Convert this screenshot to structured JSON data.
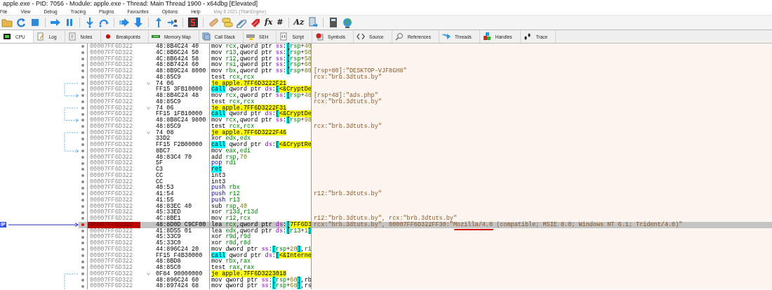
{
  "window": {
    "title": "apple.exe - PID: 7056 - Module: apple.exe - Thread: Main Thread 1900 - x64dbg [Elevated]"
  },
  "menu": {
    "items": [
      "File",
      "View",
      "Debug",
      "Tracing",
      "Plugins",
      "Favourites",
      "Options",
      "Help"
    ],
    "build_info": "May 8 2021 (TitanEngine)"
  },
  "toolbar": {
    "text_buttons": [
      "fx",
      "#",
      "Az"
    ]
  },
  "tabs": [
    {
      "label": "CPU",
      "selected": true
    },
    {
      "label": "Log",
      "selected": false
    },
    {
      "label": "Notes",
      "selected": false
    },
    {
      "label": "Breakpoints",
      "selected": false
    },
    {
      "label": "Memory Map",
      "selected": false
    },
    {
      "label": "Call Stack",
      "selected": false
    },
    {
      "label": "SEH",
      "selected": false
    },
    {
      "label": "Script",
      "selected": false
    },
    {
      "label": "Symbols",
      "selected": false
    },
    {
      "label": "Source",
      "selected": false
    },
    {
      "label": "References",
      "selected": false
    },
    {
      "label": "Threads",
      "selected": false
    },
    {
      "label": "Handles",
      "selected": false
    },
    {
      "label": "Trace",
      "selected": false
    }
  ],
  "disassembly": {
    "ip_label": "IP",
    "rows": [
      {
        "address": "00007FF6D322",
        "bytes": "48:8B4C24 40",
        "kind": "normal",
        "mnemonic": "mov",
        "operands": "rcx,qword ptr ss:[rsp+40",
        "selected": false,
        "jump_start": false,
        "jump_end": false
      },
      {
        "address": "00007FF6D322",
        "bytes": "4C:8B6C24 50",
        "kind": "normal",
        "mnemonic": "mov",
        "operands": "r13,qword ptr ss:[rsp+50",
        "selected": false,
        "jump_start": false,
        "jump_end": false
      },
      {
        "address": "00007FF6D322",
        "bytes": "4C:8B6424 58",
        "kind": "normal",
        "mnemonic": "mov",
        "operands": "r12,qword ptr ss:[rsp+58",
        "selected": false,
        "jump_start": false,
        "jump_end": false
      },
      {
        "address": "00007FF6D322",
        "bytes": "48:8B7424 60",
        "kind": "normal",
        "mnemonic": "mov",
        "operands": "rsi,qword ptr ss:[rsp+60",
        "selected": false,
        "jump_start": false,
        "jump_end": false
      },
      {
        "address": "00007FF6D322",
        "bytes": "48:8B9C24 8000",
        "kind": "normal",
        "mnemonic": "mov",
        "operands": "rbx,qword ptr ss:[rsp+80",
        "selected": false,
        "jump_start": false,
        "jump_end": false,
        "comment": [
          {
            "text": "[rsp+80]:\"DESKTOP-VJF8GH8\"",
            "marked": false
          }
        ]
      },
      {
        "address": "00007FF6D322",
        "bytes": "48:85C9",
        "kind": "normal",
        "mnemonic": "test",
        "operands": "rcx,rcx",
        "selected": false,
        "jump_start": false,
        "jump_end": false,
        "comment": [
          {
            "text": "rcx:\"brb.3dtuts.by\"",
            "marked": false
          }
        ]
      },
      {
        "address": "00007FF6D322",
        "bytes": "74 06",
        "kind": "jump",
        "mnemonic": "je",
        "operands": "apple.7FF6D3222F21",
        "selected": false,
        "jump_start": true,
        "jump_end": false
      },
      {
        "address": "00007FF6D322",
        "bytes": "FF15 3FB10000",
        "kind": "call",
        "mnemonic": "call",
        "operands": "qword ptr ds:[<&CryptDe",
        "selected": false,
        "jump_start": false,
        "jump_end": false
      },
      {
        "address": "00007FF6D322",
        "bytes": "48:8B4C24 48",
        "kind": "normal",
        "mnemonic": "mov",
        "operands": "rcx,qword ptr ss:[rsp+48",
        "selected": false,
        "jump_start": false,
        "jump_end": true,
        "comment": [
          {
            "text": "[rsp+48]:\"ads.php\"",
            "marked": false
          }
        ]
      },
      {
        "address": "00007FF6D322",
        "bytes": "48:85C9",
        "kind": "normal",
        "mnemonic": "test",
        "operands": "rcx,rcx",
        "selected": false,
        "jump_start": false,
        "jump_end": false,
        "comment": [
          {
            "text": "rcx:\"brb.3dtuts.by\"",
            "marked": false
          }
        ]
      },
      {
        "address": "00007FF6D322",
        "bytes": "74 06",
        "kind": "jump",
        "mnemonic": "je",
        "operands": "apple.7FF6D3222F31",
        "selected": false,
        "jump_start": true,
        "jump_end": false
      },
      {
        "address": "00007FF6D322",
        "bytes": "FF15 1FB10000",
        "kind": "call",
        "mnemonic": "call",
        "operands": "qword ptr ds:[<&CryptDe",
        "selected": false,
        "jump_start": false,
        "jump_end": false
      },
      {
        "address": "00007FF6D322",
        "bytes": "48:8B8C24 9800",
        "kind": "normal",
        "mnemonic": "mov",
        "operands": "rcx,qword ptr ss:[rsp+98",
        "selected": false,
        "jump_start": false,
        "jump_end": true
      },
      {
        "address": "00007FF6D322",
        "bytes": "48:85C9",
        "kind": "normal",
        "mnemonic": "test",
        "operands": "rcx,rcx",
        "selected": false,
        "jump_start": false,
        "jump_end": false,
        "comment": [
          {
            "text": "rcx:\"brb.3dtuts.by\"",
            "marked": false
          }
        ]
      },
      {
        "address": "00007FF6D322",
        "bytes": "74 08",
        "kind": "jump",
        "mnemonic": "je",
        "operands": "apple.7FF6D3222F46",
        "selected": false,
        "jump_start": true,
        "jump_end": false
      },
      {
        "address": "00007FF6D322",
        "bytes": "33D2",
        "kind": "normal",
        "mnemonic": "xor",
        "operands": "edx,edx",
        "selected": false,
        "jump_start": false,
        "jump_end": false
      },
      {
        "address": "00007FF6D322",
        "bytes": "FF15 F2B00000",
        "kind": "call",
        "mnemonic": "call",
        "operands": "qword ptr ds:[<&CryptRe",
        "selected": false,
        "jump_start": false,
        "jump_end": false
      },
      {
        "address": "00007FF6D322",
        "bytes": "8BC7",
        "kind": "normal",
        "mnemonic": "mov",
        "operands": "eax,edi",
        "selected": false,
        "jump_start": false,
        "jump_end": true
      },
      {
        "address": "00007FF6D322",
        "bytes": "48:83C4 70",
        "kind": "normal",
        "mnemonic": "add",
        "operands": "rsp,70",
        "selected": false,
        "jump_start": false,
        "jump_end": false
      },
      {
        "address": "00007FF6D322",
        "bytes": "5F",
        "kind": "stack",
        "mnemonic": "pop",
        "operands": "rdi",
        "selected": false,
        "jump_start": false,
        "jump_end": false
      },
      {
        "address": "00007FF6D322",
        "bytes": "C3",
        "kind": "ret",
        "mnemonic": "ret",
        "operands": "",
        "selected": false,
        "jump_start": false,
        "jump_end": false
      },
      {
        "address": "00007FF6D322",
        "bytes": "CC",
        "kind": "normal",
        "mnemonic": "int3",
        "operands": "",
        "selected": false,
        "jump_start": false,
        "jump_end": false
      },
      {
        "address": "00007FF6D322",
        "bytes": "CC",
        "kind": "normal",
        "mnemonic": "int3",
        "operands": "",
        "selected": false,
        "jump_start": false,
        "jump_end": false
      },
      {
        "address": "00007FF6D322",
        "bytes": "40:53",
        "kind": "stack",
        "mnemonic": "push",
        "operands": "rbx",
        "selected": false,
        "jump_start": false,
        "jump_end": false
      },
      {
        "address": "00007FF6D322",
        "bytes": "41:54",
        "kind": "stack",
        "mnemonic": "push",
        "operands": "r12",
        "selected": false,
        "jump_start": false,
        "jump_end": false,
        "comment": [
          {
            "text": "r12:\"brb.3dtuts.by\"",
            "marked": false
          }
        ]
      },
      {
        "address": "00007FF6D322",
        "bytes": "41:55",
        "kind": "stack",
        "mnemonic": "push",
        "operands": "r13",
        "selected": false,
        "jump_start": false,
        "jump_end": false
      },
      {
        "address": "00007FF6D322",
        "bytes": "48:83EC 40",
        "kind": "normal",
        "mnemonic": "sub",
        "operands": "rsp,40",
        "selected": false,
        "jump_start": false,
        "jump_end": false
      },
      {
        "address": "00007FF6D322",
        "bytes": "45:33ED",
        "kind": "normal",
        "mnemonic": "xor",
        "operands": "r13d,r13d",
        "selected": false,
        "jump_start": false,
        "jump_end": false
      },
      {
        "address": "00007FF6D322",
        "bytes": "4C:8BE1",
        "kind": "normal",
        "mnemonic": "mov",
        "operands": "r12,rcx",
        "selected": false,
        "jump_start": false,
        "jump_end": false,
        "comment": [
          {
            "text": "r12:\"brb.3dtuts.by\", rcx:\"brb.3dtuts.by\"",
            "marked": false
          }
        ]
      },
      {
        "address": "00007FF6D322",
        "bytes": "48:8D0D C9CF00",
        "kind": "normal",
        "mnemonic": "lea",
        "operands": "rcx,qword ptr ds:[7FF6D3",
        "selected": true,
        "jump_start": false,
        "jump_end": false,
        "comment": [
          {
            "text": "rcx:\"brb.3dtuts.by\", 00007FF6D322FF30:\"",
            "marked": false
          },
          {
            "text": "Mozilla/4.0",
            "marked": true
          },
          {
            "text": " (compatible; MSIE 8.0; Windows NT 6.1; Trident/4.0)\"",
            "marked": false
          }
        ]
      },
      {
        "address": "00007FF6D322",
        "bytes": "41:8D55 01",
        "kind": "normal",
        "mnemonic": "lea",
        "operands": "edx,qword ptr ds:[r13+1]",
        "selected": false,
        "jump_start": false,
        "jump_end": false
      },
      {
        "address": "00007FF6D322",
        "bytes": "45:33C9",
        "kind": "normal",
        "mnemonic": "xor",
        "operands": "r9d,r9d",
        "selected": false,
        "jump_start": false,
        "jump_end": false
      },
      {
        "address": "00007FF6D322",
        "bytes": "45:33C0",
        "kind": "normal",
        "mnemonic": "xor",
        "operands": "r8d,r8d",
        "selected": false,
        "jump_start": false,
        "jump_end": false
      },
      {
        "address": "00007FF6D322",
        "bytes": "44:896C24 20",
        "kind": "normal",
        "mnemonic": "mov",
        "operands": "dword ptr ss:[rsp+20],r1",
        "selected": false,
        "jump_start": false,
        "jump_end": false
      },
      {
        "address": "00007FF6D322",
        "bytes": "FF15 F4B30000",
        "kind": "call",
        "mnemonic": "call",
        "operands": "qword ptr ds:[<&Interne",
        "selected": false,
        "jump_start": false,
        "jump_end": false
      },
      {
        "address": "00007FF6D322",
        "bytes": "48:8BD8",
        "kind": "normal",
        "mnemonic": "mov",
        "operands": "rbx,rax",
        "selected": false,
        "jump_start": false,
        "jump_end": false
      },
      {
        "address": "00007FF6D322",
        "bytes": "48:85C0",
        "kind": "normal",
        "mnemonic": "test",
        "operands": "rax,rax",
        "selected": false,
        "jump_start": false,
        "jump_end": false
      },
      {
        "address": "00007FF6D322",
        "bytes": "0F84 90000000",
        "kind": "jump",
        "mnemonic": "je",
        "operands": "apple.7FF6D3223018",
        "selected": false,
        "jump_start": true,
        "jump_end": false
      },
      {
        "address": "00007FF6D322",
        "bytes": "48:896C24 60",
        "kind": "normal",
        "mnemonic": "mov",
        "operands": "qword ptr ss:[rsp+60],rb",
        "selected": false,
        "jump_start": false,
        "jump_end": false
      },
      {
        "address": "00007FF6D322",
        "bytes": "48:897424 68",
        "kind": "normal",
        "mnemonic": "mov",
        "operands": "qword ptr ss:[rsp+68],rs",
        "selected": false,
        "jump_start": false,
        "jump_end": false
      }
    ]
  }
}
